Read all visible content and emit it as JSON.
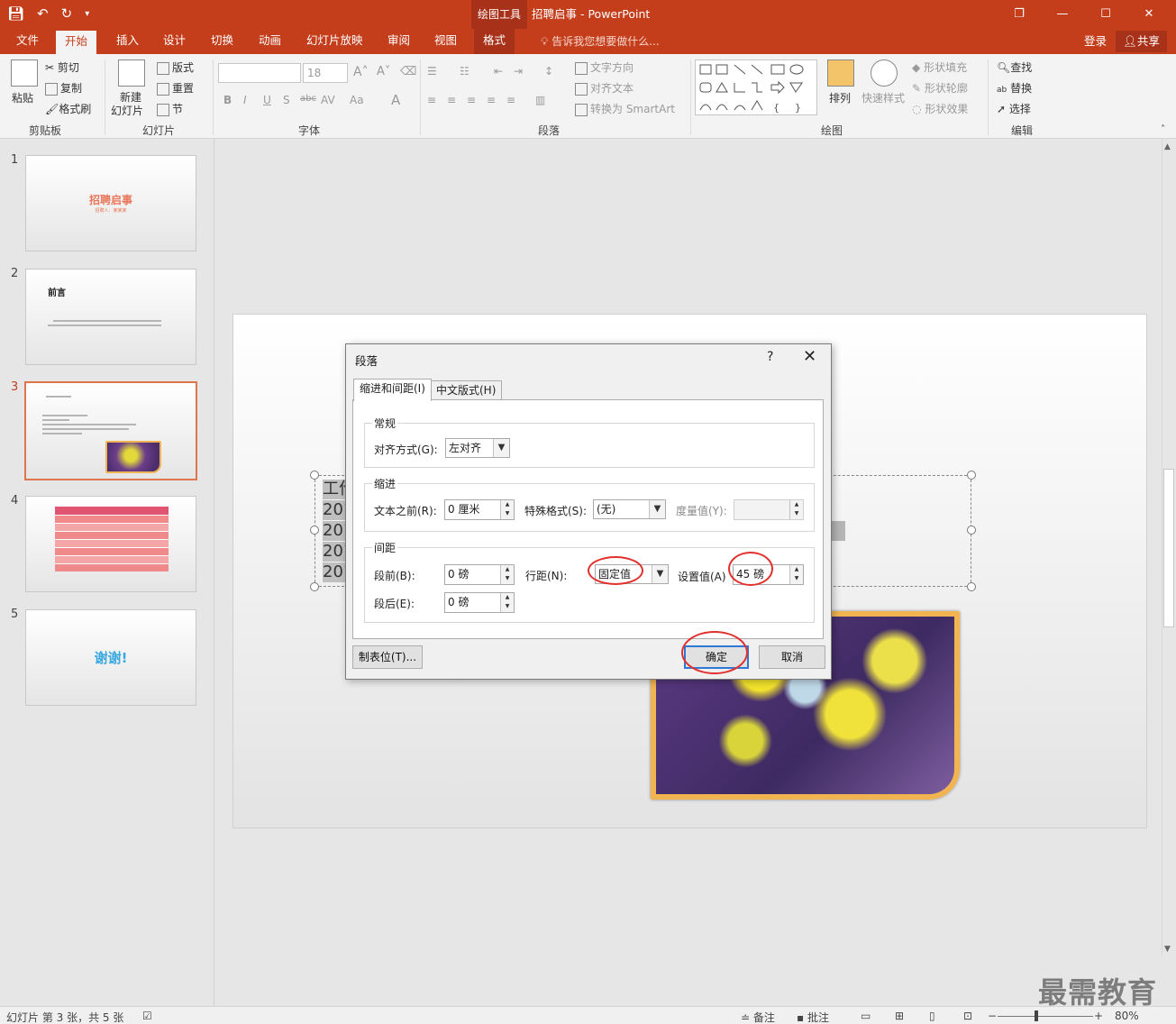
{
  "window": {
    "context_tool": "绘图工具",
    "title": "招聘启事 - PowerPoint",
    "win_restore": "❐",
    "win_minimize": "—",
    "win_maximize": "☐",
    "win_close": "✕"
  },
  "tabs": [
    "文件",
    "开始",
    "插入",
    "设计",
    "切换",
    "动画",
    "幻灯片放映",
    "审阅",
    "视图",
    "格式"
  ],
  "tell_me": "告诉我您想要做什么...",
  "login": "登录",
  "share": "共享",
  "ribbon": {
    "clipboard": {
      "label": "剪贴板",
      "paste": "粘贴",
      "cut": "剪切",
      "copy": "复制",
      "format_painter": "格式刷"
    },
    "slides": {
      "label": "幻灯片",
      "new_slide_1": "新建",
      "new_slide_2": "幻灯片",
      "layout": "版式",
      "reset": "重置",
      "section": "节"
    },
    "font": {
      "label": "字体",
      "size": "18"
    },
    "paragraph": {
      "label": "段落",
      "text_direction": "文字方向",
      "align_text": "对齐文本",
      "convert_smartart": "转换为 SmartArt"
    },
    "drawing": {
      "label": "绘图",
      "arrange": "排列",
      "quick_styles": "快速样式",
      "shape_fill": "形状填充",
      "shape_outline": "形状轮廓",
      "shape_effects": "形状效果"
    },
    "editing": {
      "label": "编辑",
      "find": "查找",
      "replace": "替换",
      "select": "选择"
    }
  },
  "thumbnails": {
    "numbers": [
      "1",
      "2",
      "3",
      "4",
      "5"
    ],
    "slide1_title": "招聘启事",
    "slide1_sub": "招聘人：某某某",
    "slide2_title": "前言",
    "slide5_text": "谢谢!"
  },
  "slide_text": [
    "工作",
    "201",
    "201",
    "201",
    "201"
  ],
  "dialog": {
    "title": "段落",
    "help": "?",
    "close": "✕",
    "tab_indent": "缩进和间距(I)",
    "tab_chinese": "中文版式(H)",
    "general": {
      "legend": "常规",
      "alignment_label": "对齐方式(G):",
      "alignment_value": "左对齐"
    },
    "indent": {
      "legend": "缩进",
      "before_text_label": "文本之前(R):",
      "before_text_value": "0 厘米",
      "special_label": "特殊格式(S):",
      "special_value": "(无)",
      "by_label": "度量值(Y):",
      "by_value": ""
    },
    "spacing": {
      "legend": "间距",
      "before_label": "段前(B):",
      "before_value": "0 磅",
      "after_label": "段后(E):",
      "after_value": "0 磅",
      "line_label": "行距(N):",
      "line_value": "固定值",
      "at_label": "设置值(A)",
      "at_value": "45 磅"
    },
    "tabs_button": "制表位(T)...",
    "ok": "确定",
    "cancel": "取消"
  },
  "status": {
    "slide_info": "幻灯片 第 3 张，共 5 张",
    "notes": "备注",
    "comments": "批注",
    "zoom": "80%"
  },
  "watermark": "最需教育",
  "colors": {
    "accent": "#c43e1c",
    "highlight_ring": "#e2302d",
    "primary_button": "#2f79d6"
  }
}
